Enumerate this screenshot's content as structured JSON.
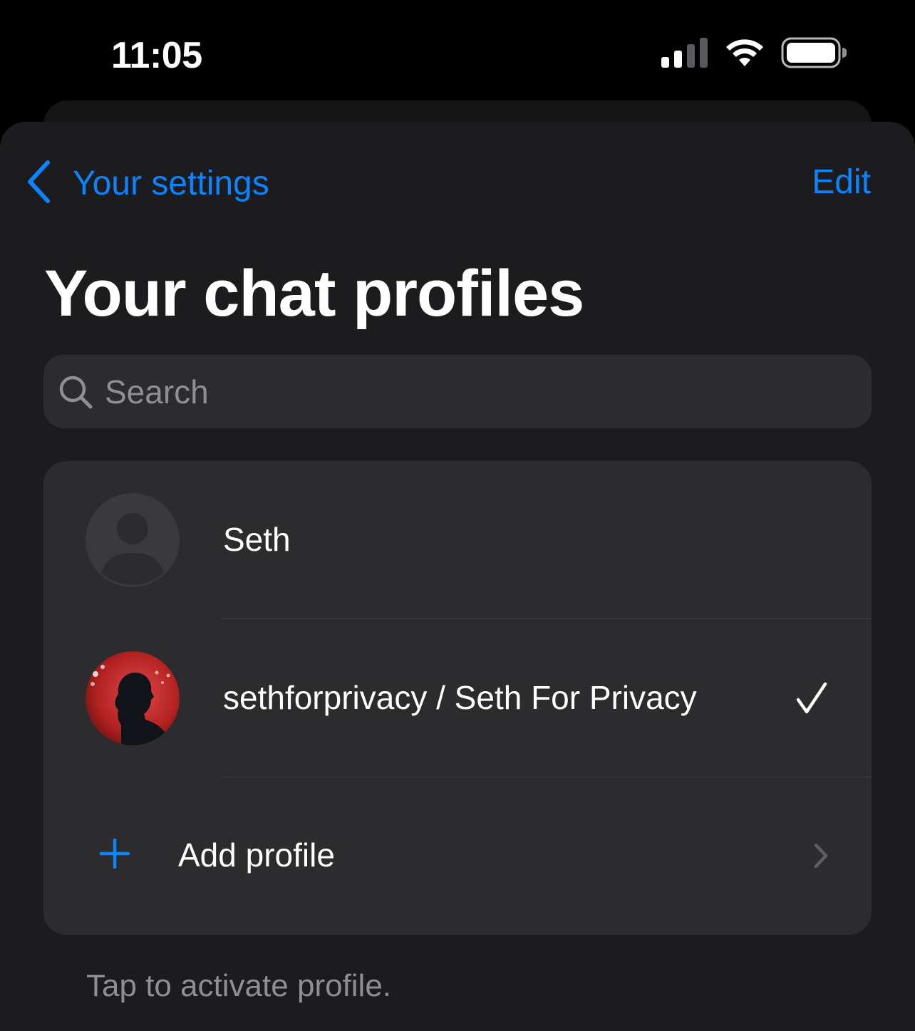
{
  "status_bar": {
    "time": "11:05",
    "signal_icon": "cellular-signal-icon",
    "wifi_icon": "wifi-icon",
    "battery_icon": "battery-icon"
  },
  "nav": {
    "back_label": "Your settings",
    "back_icon": "chevron-left-icon",
    "edit_label": "Edit"
  },
  "page": {
    "title": "Your chat profiles"
  },
  "search": {
    "placeholder": "Search",
    "icon": "search-icon"
  },
  "profiles": [
    {
      "name": "Seth",
      "avatar": "default-person-avatar",
      "selected": false
    },
    {
      "name": "sethforprivacy / Seth For Privacy",
      "avatar": "photo-avatar",
      "selected": true
    }
  ],
  "add_profile": {
    "label": "Add profile",
    "icon": "plus-icon",
    "chevron": "chevron-right-icon"
  },
  "footer": {
    "note": "Tap to activate profile."
  },
  "colors": {
    "accent": "#0a84ff",
    "background": "#000000",
    "sheet": "#1c1c1e",
    "group": "#2c2c2e",
    "secondary_text": "#8e8e93"
  }
}
